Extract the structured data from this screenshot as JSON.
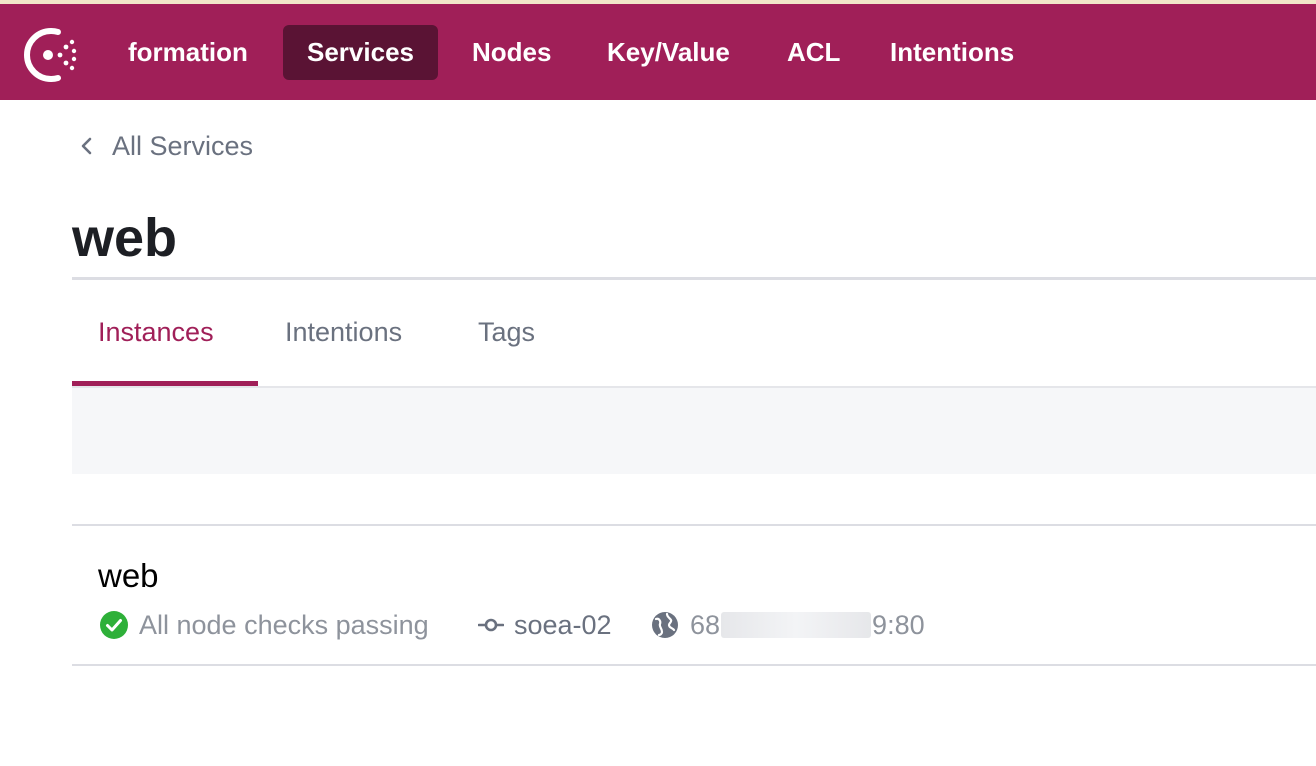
{
  "nav": {
    "items": [
      {
        "label": "formation"
      },
      {
        "label": "Services"
      },
      {
        "label": "Nodes"
      },
      {
        "label": "Key/Value"
      },
      {
        "label": "ACL"
      },
      {
        "label": "Intentions"
      }
    ],
    "active": "Services",
    "logo_icon": "consul-logo-icon",
    "brand_color": "#a01f58"
  },
  "breadcrumb": {
    "label": "All Services",
    "icon": "chevron-left-icon"
  },
  "page": {
    "title": "web"
  },
  "tabs": [
    {
      "label": "Instances"
    },
    {
      "label": "Intentions"
    },
    {
      "label": "Tags"
    }
  ],
  "active_tab": "Instances",
  "instances": [
    {
      "name": "web",
      "health": "All node checks passing",
      "health_icon": "check-circle-icon",
      "health_color": "#2eb039",
      "node": "soea-02",
      "node_icon": "node-icon",
      "address_prefix": "68",
      "address_suffix": "9:80",
      "address_icon": "globe-icon"
    }
  ]
}
